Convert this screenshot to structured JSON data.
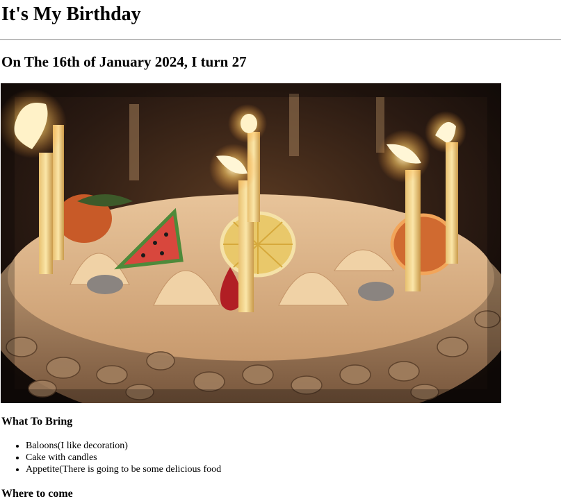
{
  "page": {
    "title": "It's My Birthday",
    "subtitle": "On The 16th of January 2024, I turn 27",
    "image": {
      "description_icon": "birthday-cake-photo"
    },
    "what_to_bring": {
      "heading": "What To Bring",
      "items": [
        "Baloons(I like decoration)",
        "Cake with candles",
        "Appetite(There is going to be some delicious food"
      ]
    },
    "where_to_come": {
      "heading": "Where to come"
    }
  }
}
